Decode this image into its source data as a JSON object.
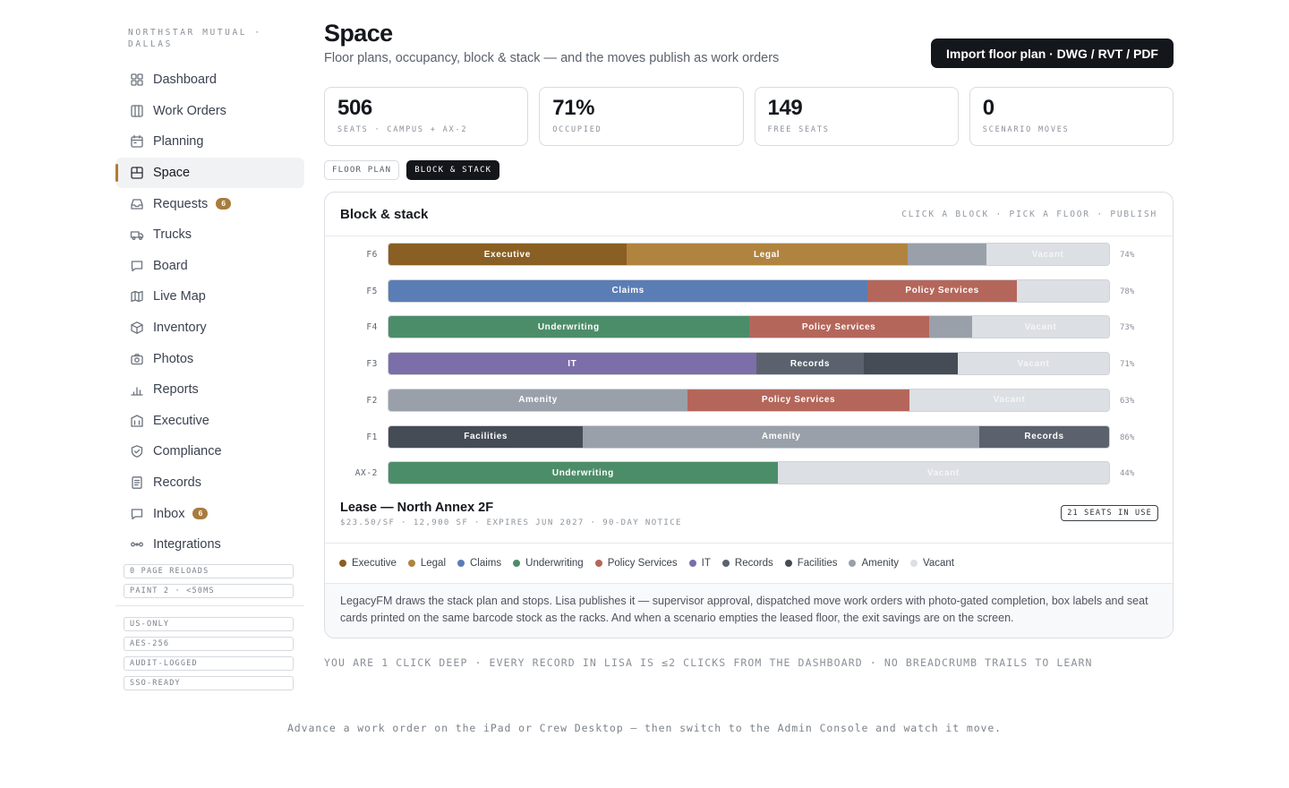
{
  "sidebar": {
    "org": "NORTHSTAR MUTUAL · DALLAS",
    "items": [
      {
        "label": "Dashboard",
        "icon": "grid-icon",
        "name": "dashboard"
      },
      {
        "label": "Work Orders",
        "icon": "columns-icon",
        "name": "work-orders"
      },
      {
        "label": "Planning",
        "icon": "calendar-icon",
        "name": "planning"
      },
      {
        "label": "Space",
        "icon": "floorplan-icon",
        "name": "space",
        "active": true
      },
      {
        "label": "Requests",
        "icon": "inbox-tray-icon",
        "name": "requests",
        "badge": "6"
      },
      {
        "label": "Trucks",
        "icon": "truck-icon",
        "name": "trucks"
      },
      {
        "label": "Board",
        "icon": "chat-bubble-icon",
        "name": "board"
      },
      {
        "label": "Live Map",
        "icon": "map-icon",
        "name": "live-map"
      },
      {
        "label": "Inventory",
        "icon": "box-icon",
        "name": "inventory"
      },
      {
        "label": "Photos",
        "icon": "camera-icon",
        "name": "photos"
      },
      {
        "label": "Reports",
        "icon": "bar-chart-icon",
        "name": "reports"
      },
      {
        "label": "Executive",
        "icon": "building-icon",
        "name": "executive"
      },
      {
        "label": "Compliance",
        "icon": "shield-icon",
        "name": "compliance"
      },
      {
        "label": "Records",
        "icon": "document-icon",
        "name": "records"
      },
      {
        "label": "Inbox",
        "icon": "message-icon",
        "name": "inbox",
        "badge": "6"
      },
      {
        "label": "Integrations",
        "icon": "link-icon",
        "name": "integrations"
      }
    ],
    "perf_tags": [
      "0 PAGE RELOADS",
      "PAINT 2 · <50MS"
    ],
    "security_tags": [
      "US-ONLY",
      "AES-256",
      "AUDIT-LOGGED",
      "SSO-READY"
    ]
  },
  "header": {
    "title": "Space",
    "subtitle": "Floor plans, occupancy, block & stack — and the moves publish as work orders",
    "import_label": "Import floor plan · DWG / RVT / PDF"
  },
  "stats": [
    {
      "value": "506",
      "label": "SEATS · CAMPUS + AX-2"
    },
    {
      "value": "71%",
      "label": "OCCUPIED"
    },
    {
      "value": "149",
      "label": "FREE SEATS"
    },
    {
      "value": "0",
      "label": "SCENARIO MOVES"
    }
  ],
  "tabs": [
    {
      "label": "FLOOR PLAN",
      "active": false
    },
    {
      "label": "BLOCK & STACK",
      "active": true
    }
  ],
  "card": {
    "title": "Block & stack",
    "hint": "CLICK A BLOCK · PICK A FLOOR · PUBLISH"
  },
  "colors": {
    "Executive": "#8a5f23",
    "Legal": "#b0843f",
    "Claims": "#5b7db5",
    "Underwriting": "#4c8d69",
    "Policy Services": "#b5665a",
    "IT": "#7b6ea9",
    "Records": "#5b626d",
    "Facilities": "#454c56",
    "Amenity": "#9aa0a9",
    "Vacant": "#dcdfe3"
  },
  "chart_data": {
    "type": "bar",
    "orientation": "horizontal-stacked",
    "floors": [
      {
        "floor": "F6",
        "pct": "74%",
        "segments": [
          {
            "dept": "Executive",
            "share": 0.33,
            "label": "Executive"
          },
          {
            "dept": "Legal",
            "share": 0.39,
            "label": "Legal"
          },
          {
            "dept": "Amenity",
            "share": 0.11,
            "label": ""
          },
          {
            "dept": "Vacant",
            "share": 0.17,
            "label": "Vacant"
          }
        ]
      },
      {
        "floor": "F5",
        "pct": "78%",
        "segments": [
          {
            "dept": "Claims",
            "share": 0.665,
            "label": "Claims"
          },
          {
            "dept": "Policy Services",
            "share": 0.207,
            "label": "Policy Services"
          },
          {
            "dept": "Vacant",
            "share": 0.128,
            "label": ""
          }
        ]
      },
      {
        "floor": "F4",
        "pct": "73%",
        "segments": [
          {
            "dept": "Underwriting",
            "share": 0.5,
            "label": "Underwriting"
          },
          {
            "dept": "Policy Services",
            "share": 0.25,
            "label": "Policy Services"
          },
          {
            "dept": "Amenity",
            "share": 0.06,
            "label": ""
          },
          {
            "dept": "Vacant",
            "share": 0.19,
            "label": "Vacant"
          }
        ]
      },
      {
        "floor": "F3",
        "pct": "71%",
        "segments": [
          {
            "dept": "IT",
            "share": 0.51,
            "label": "IT"
          },
          {
            "dept": "Records",
            "share": 0.15,
            "label": "Records"
          },
          {
            "dept": "Facilities",
            "share": 0.13,
            "label": ""
          },
          {
            "dept": "Vacant",
            "share": 0.21,
            "label": "Vacant"
          }
        ]
      },
      {
        "floor": "F2",
        "pct": "63%",
        "segments": [
          {
            "dept": "Amenity",
            "share": 0.415,
            "label": "Amenity"
          },
          {
            "dept": "Policy Services",
            "share": 0.308,
            "label": "Policy Services"
          },
          {
            "dept": "Vacant",
            "share": 0.277,
            "label": "Vacant"
          }
        ]
      },
      {
        "floor": "F1",
        "pct": "86%",
        "segments": [
          {
            "dept": "Facilities",
            "share": 0.27,
            "label": "Facilities"
          },
          {
            "dept": "Amenity",
            "share": 0.55,
            "label": "Amenity"
          },
          {
            "dept": "Records",
            "share": 0.18,
            "label": "Records"
          }
        ]
      },
      {
        "floor": "AX-2",
        "pct": "44%",
        "segments": [
          {
            "dept": "Underwriting",
            "share": 0.54,
            "label": "Underwriting"
          },
          {
            "dept": "Vacant",
            "share": 0.46,
            "label": "Vacant"
          }
        ]
      }
    ]
  },
  "lease": {
    "title": "Lease — North Annex 2F",
    "meta": "$23.50/SF · 12,900 SF · EXPIRES JUN 2027 · 90-DAY NOTICE",
    "badge": "21 SEATS IN USE"
  },
  "legend": [
    "Executive",
    "Legal",
    "Claims",
    "Underwriting",
    "Policy Services",
    "IT",
    "Records",
    "Facilities",
    "Amenity",
    "Vacant"
  ],
  "card_footer": "LegacyFM draws the stack plan and stops. Lisa publishes it — supervisor approval, dispatched move work orders with photo-gated completion, box labels and seat cards printed on the same barcode stock as the racks. And when a scenario empties the leased floor, the exit savings are on the screen.",
  "depth_note": "YOU ARE 1 CLICK DEEP · EVERY RECORD IN LISA IS ≤2 CLICKS FROM THE DASHBOARD · NO BREADCRUMB TRAILS TO LEARN",
  "footer": "Advance a work order on the iPad or Crew Desktop — then switch to the Admin Console and watch it move."
}
